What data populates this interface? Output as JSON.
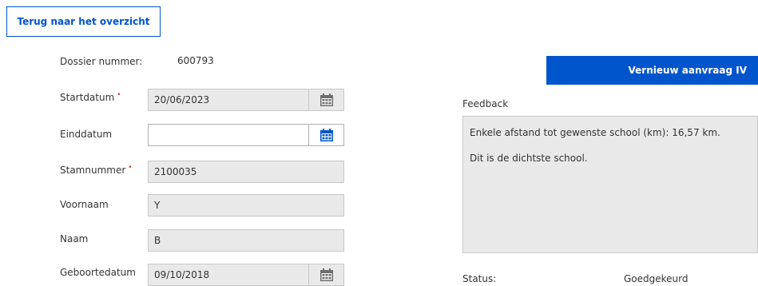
{
  "back_button": {
    "label": "Terug naar het overzicht"
  },
  "renew_button": {
    "label": "Vernieuw aanvraag IV"
  },
  "form": {
    "dossier": {
      "label": "Dossier nummer:",
      "value": "600793"
    },
    "startdatum": {
      "label": "Startdatum",
      "value": "20/06/2023",
      "required": true
    },
    "einddatum": {
      "label": "Einddatum",
      "value": ""
    },
    "stamnummer": {
      "label": "Stamnummer",
      "value": "2100035",
      "required": true
    },
    "voornaam": {
      "label": "Voornaam",
      "value": "Y"
    },
    "naam": {
      "label": "Naam",
      "value": "B"
    },
    "geboortedatum": {
      "label": "Geboortedatum",
      "value": "09/10/2018"
    }
  },
  "required_marker": "•",
  "feedback": {
    "label": "Feedback",
    "lines": [
      "Enkele afstand tot gewenste school (km): 16,57 km.",
      "Dit is de dichtste school."
    ]
  },
  "status": {
    "label": "Status:",
    "value": "Goedgekeurd"
  },
  "colors": {
    "accent": "#0055cc",
    "required": "#e0323c",
    "readonly_bg": "#e9e9e9",
    "calendar_inactive": "#6e6e6e"
  },
  "icons": {
    "calendar": "calendar-icon"
  }
}
